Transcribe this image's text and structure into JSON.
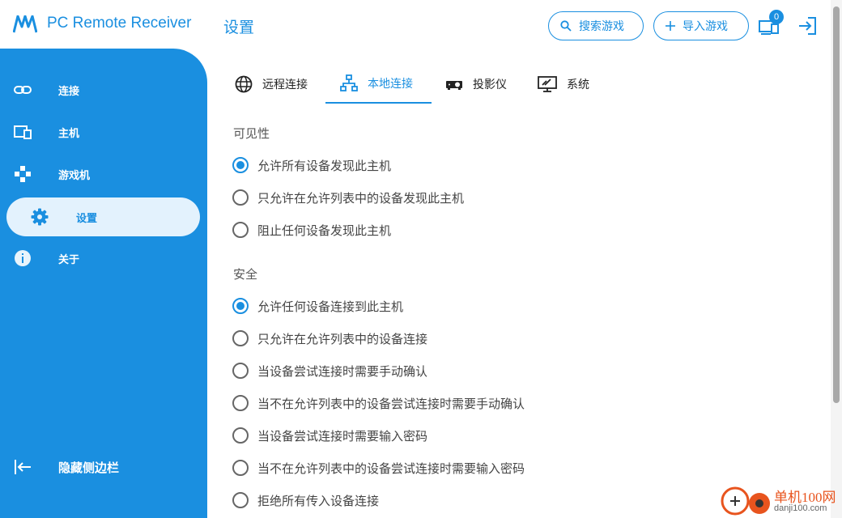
{
  "app": {
    "title": "PC Remote Receiver",
    "page_title": "设置"
  },
  "header": {
    "search_games_label": "搜索游戏",
    "import_games_label": "导入游戏",
    "devices_badge": "0"
  },
  "sidebar": {
    "items": [
      {
        "label": "连接",
        "icon": "link-icon"
      },
      {
        "label": "主机",
        "icon": "devices-icon"
      },
      {
        "label": "游戏机",
        "icon": "gamepad-icon"
      },
      {
        "label": "设置",
        "icon": "gear-icon",
        "active": true
      },
      {
        "label": "关于",
        "icon": "info-icon"
      }
    ],
    "hide_label": "隐藏侧边栏"
  },
  "tabs": [
    {
      "label": "远程连接",
      "icon": "globe-icon"
    },
    {
      "label": "本地连接",
      "icon": "network-icon",
      "active": true
    },
    {
      "label": "投影仪",
      "icon": "projector-icon"
    },
    {
      "label": "系统",
      "icon": "monitor-icon"
    }
  ],
  "visibility": {
    "label": "可见性",
    "options": [
      {
        "label": "允许所有设备发现此主机",
        "checked": true
      },
      {
        "label": "只允许在允许列表中的设备发现此主机",
        "checked": false
      },
      {
        "label": "阻止任何设备发现此主机",
        "checked": false
      }
    ]
  },
  "security": {
    "label": "安全",
    "options": [
      {
        "label": "允许任何设备连接到此主机",
        "checked": true
      },
      {
        "label": "只允许在允许列表中的设备连接",
        "checked": false
      },
      {
        "label": "当设备尝试连接时需要手动确认",
        "checked": false
      },
      {
        "label": "当不在允许列表中的设备尝试连接时需要手动确认",
        "checked": false
      },
      {
        "label": "当设备尝试连接时需要输入密码",
        "checked": false
      },
      {
        "label": "当不在允许列表中的设备尝试连接时需要输入密码",
        "checked": false
      },
      {
        "label": "拒绝所有传入设备连接",
        "checked": false
      }
    ]
  },
  "watermark": {
    "title": "单机100网",
    "url": "danji100.com"
  },
  "colors": {
    "accent": "#1a8fe0",
    "active_bg": "#e3f2fd"
  }
}
